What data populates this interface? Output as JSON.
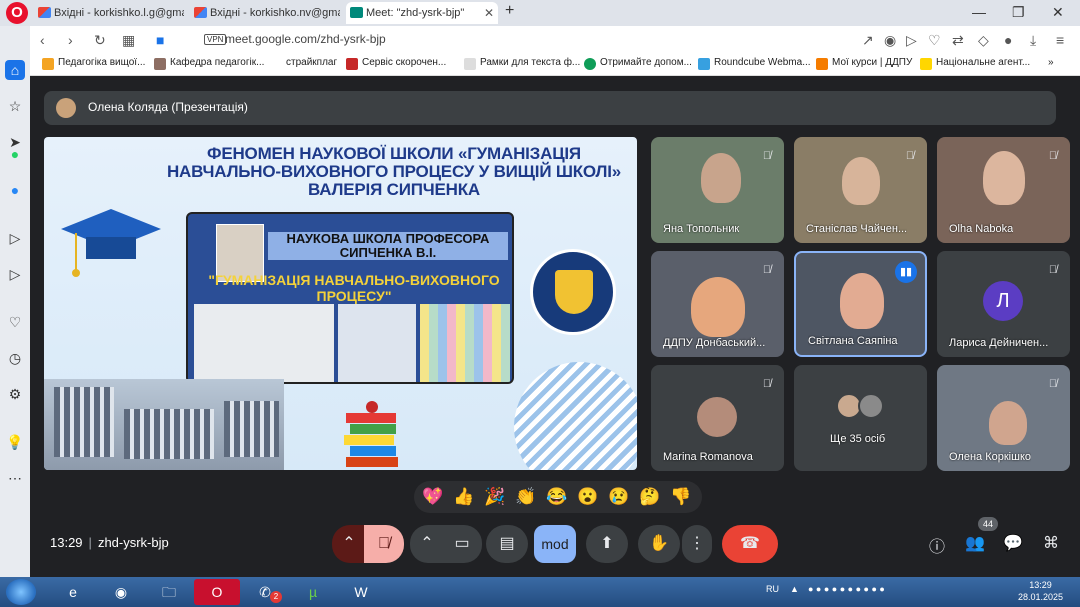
{
  "browser": {
    "tabs": [
      {
        "label": "Вхідні - korkishko.l.g@gma"
      },
      {
        "label": "Вхідні - korkishko.nv@gma"
      },
      {
        "label": "Meet: \"zhd-ysrk-bjp\""
      }
    ],
    "url": "meet.google.com/zhd-ysrk-bjp",
    "vpn_label": "VPN",
    "bookmarks": [
      {
        "label": "Педагогіка вищої..."
      },
      {
        "label": "Кафедра педагогік..."
      },
      {
        "label": "страйкплаг"
      },
      {
        "label": "Сервіс скорочен..."
      },
      {
        "label": "Рамки для текста ф..."
      },
      {
        "label": "Отримайте допом..."
      },
      {
        "label": "Roundcube Webma..."
      },
      {
        "label": "Мої курси | ДДПУ"
      },
      {
        "label": "Національне агент..."
      }
    ]
  },
  "meet": {
    "presenter": "Олена Коляда (Презентація)",
    "slide": {
      "title": "ФЕНОМЕН НАУКОВОЇ ШКОЛИ «ГУМАНІЗАЦІЯ НАВЧАЛЬНО-ВИХОВНОГО ПРОЦЕСУ У ВИЩІЙ ШКОЛІ» ВАЛЕРІЯ СИПЧЕНКА",
      "board_line1": "НАУКОВА ШКОЛА ПРОФЕСОРА СИПЧЕНКА В.І.",
      "board_line2": "\"ГУМАНІЗАЦІЯ НАВЧАЛЬНО-ВИХОВНОГО ПРОЦЕСУ\""
    },
    "participants": [
      {
        "name": "Яна Топольник"
      },
      {
        "name": "Станіслав Чайчен..."
      },
      {
        "name": "Olha Naboka"
      },
      {
        "name": "ДДПУ Донбаський..."
      },
      {
        "name": "Світлана Саяпіна"
      },
      {
        "name": "Лариса Дейничен...",
        "initial": "Л"
      },
      {
        "name": "Marina Romanova"
      },
      {
        "name": "Ще 35 осіб"
      },
      {
        "name": "Олена Коркішко"
      }
    ],
    "reactions": [
      "💖",
      "👍",
      "🎉",
      "👏",
      "😂",
      "😮",
      "😢",
      "🤔",
      "👎"
    ],
    "clock": "13:29",
    "meeting_code": "zhd-ysrk-bjp",
    "people_count": "44",
    "blue_button_text": "mod"
  },
  "taskbar": {
    "lang": "RU",
    "time": "13:29",
    "date": "28.01.2025",
    "viber_badge": "2"
  },
  "colors": {
    "meet_bg": "#202124",
    "tile_bg": "#3c4043",
    "end_call": "#ea4335",
    "accent_blue": "#8ab4f8",
    "slide_title": "#1e3a8a"
  }
}
